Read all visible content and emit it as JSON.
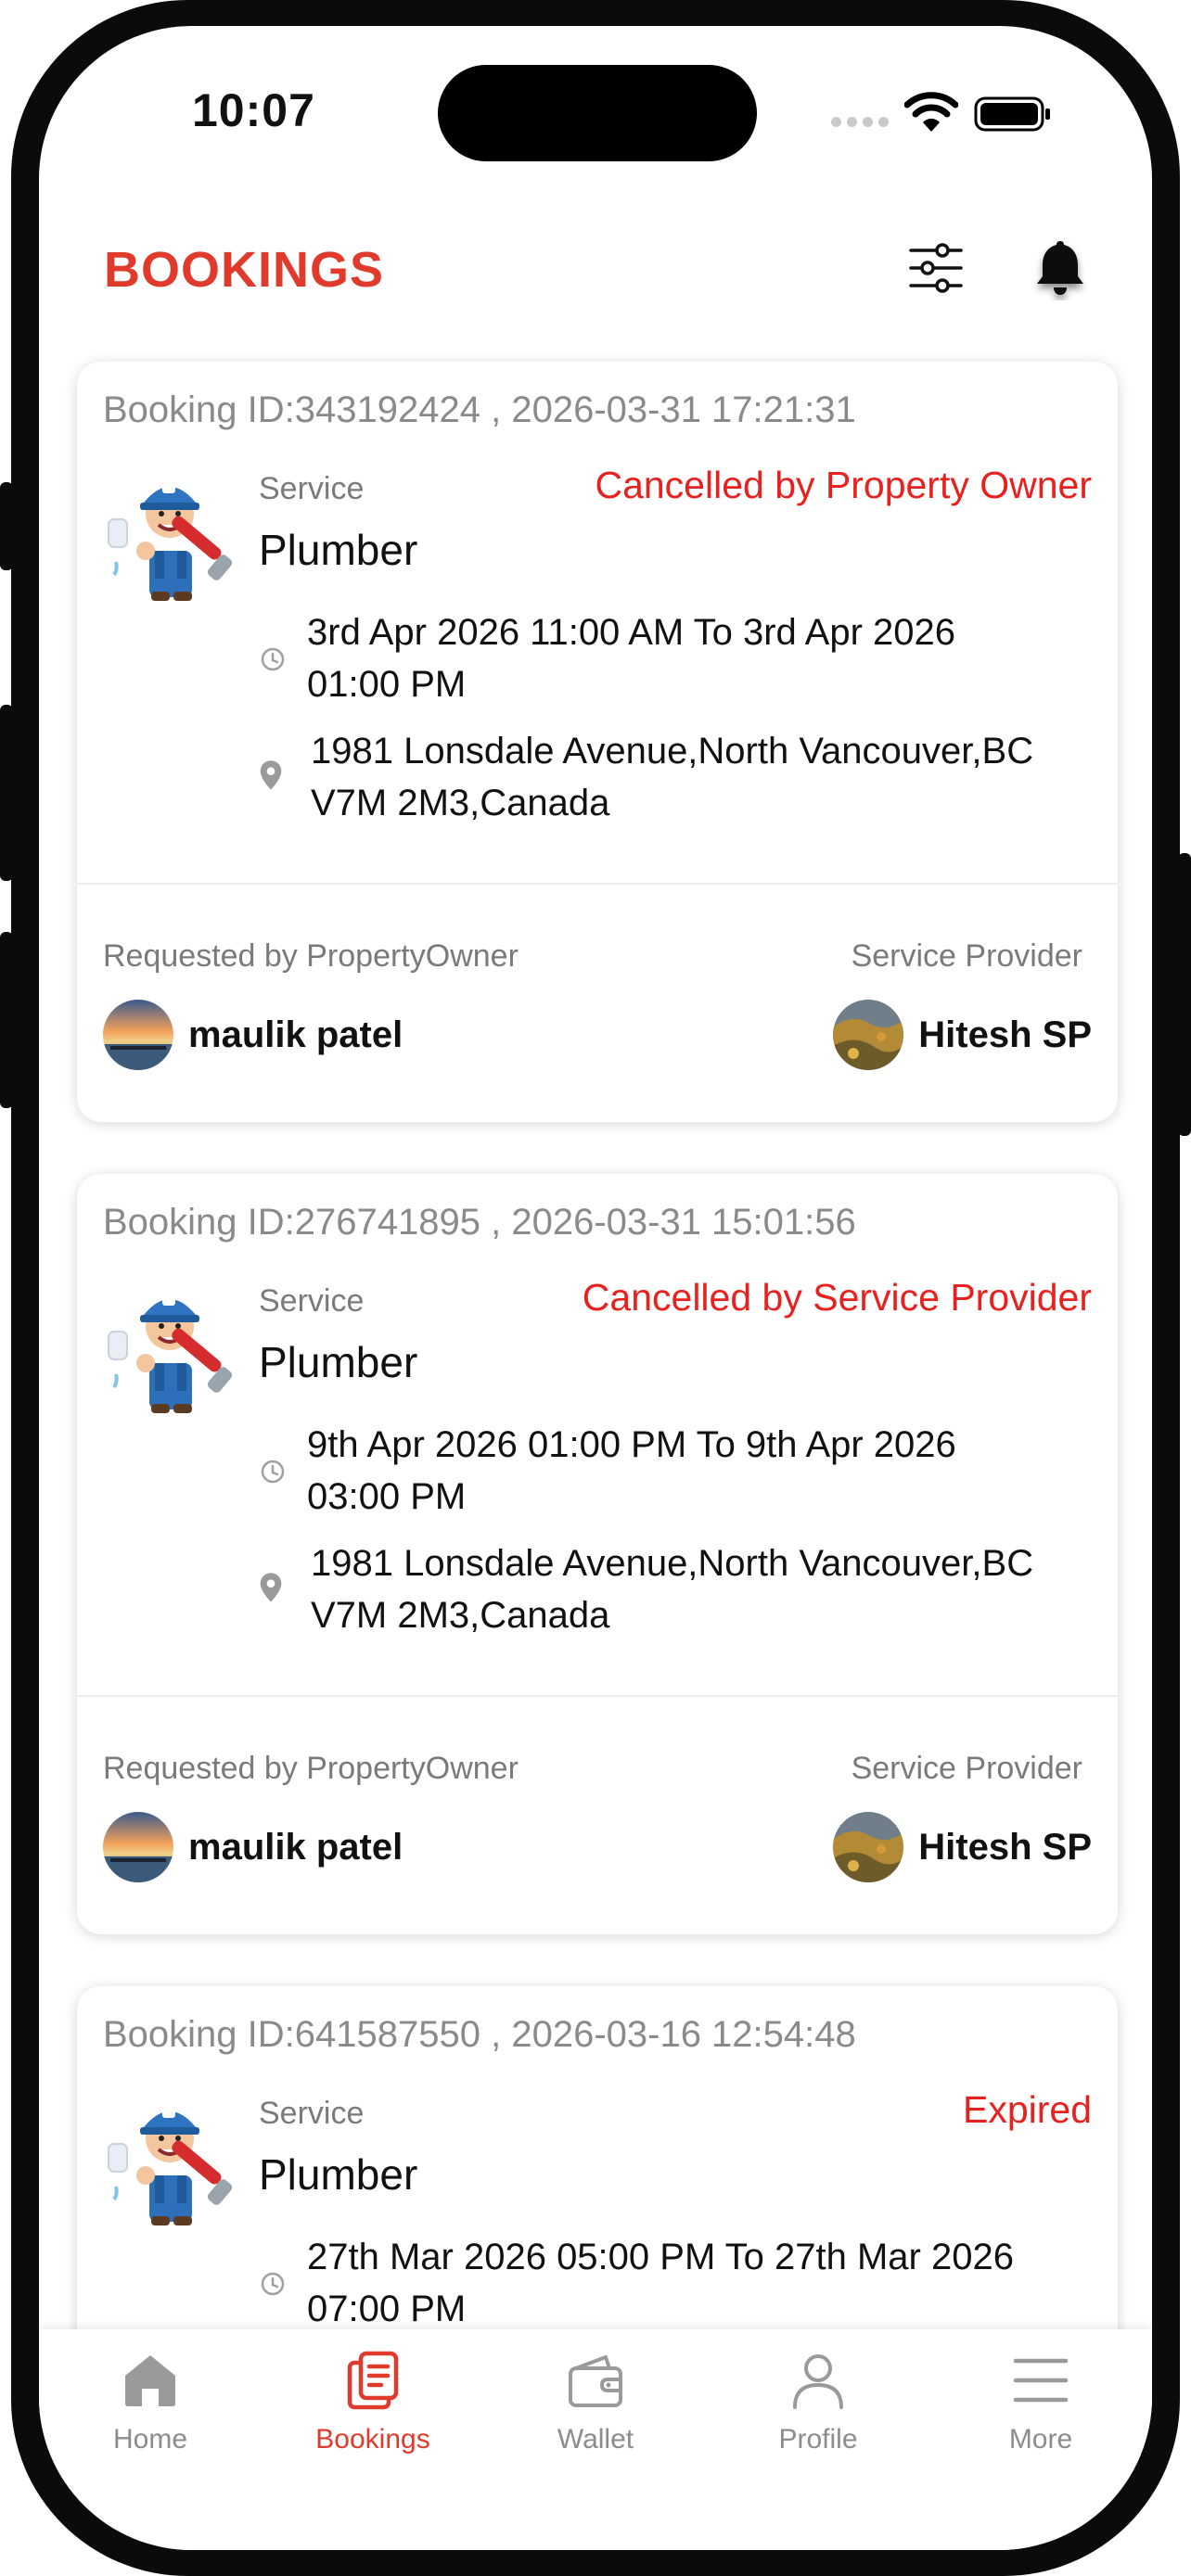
{
  "status_bar": {
    "time": "10:07"
  },
  "header": {
    "title": "BOOKINGS"
  },
  "bookings": [
    {
      "id_line": "Booking ID:343192424 , 2026-03-31 17:21:31",
      "service_label": "Service",
      "status": "Cancelled by Property Owner",
      "service_name": "Plumber",
      "time_line1": "3rd Apr 2026 11:00 AM To 3rd Apr 2026",
      "time_line2": "01:00 PM",
      "address_line1": "1981 Lonsdale Avenue,North Vancouver,BC",
      "address_line2": "V7M 2M3,Canada",
      "requested_label": "Requested by PropertyOwner",
      "requester": "maulik patel",
      "provider_label": "Service Provider",
      "provider": "Hitesh SP"
    },
    {
      "id_line": "Booking ID:276741895 , 2026-03-31 15:01:56",
      "service_label": "Service",
      "status": "Cancelled by Service Provider",
      "service_name": "Plumber",
      "time_line1": "9th Apr 2026 01:00 PM To 9th Apr 2026",
      "time_line2": "03:00 PM",
      "address_line1": "1981 Lonsdale Avenue,North Vancouver,BC",
      "address_line2": "V7M 2M3,Canada",
      "requested_label": "Requested by PropertyOwner",
      "requester": "maulik patel",
      "provider_label": "Service Provider",
      "provider": "Hitesh SP"
    },
    {
      "id_line": "Booking ID:641587550 , 2026-03-16 12:54:48",
      "service_label": "Service",
      "status": "Expired",
      "service_name": "Plumber",
      "time_line1": "27th Mar 2026 05:00 PM To 27th Mar 2026",
      "time_line2": "07:00 PM"
    }
  ],
  "tabs": [
    {
      "label": "Home",
      "icon": "home-icon",
      "active": false
    },
    {
      "label": "Bookings",
      "icon": "bookings-icon",
      "active": true
    },
    {
      "label": "Wallet",
      "icon": "wallet-icon",
      "active": false
    },
    {
      "label": "Profile",
      "icon": "profile-icon",
      "active": false
    },
    {
      "label": "More",
      "icon": "menu-icon",
      "active": false
    }
  ],
  "colors": {
    "accent": "#e03a2c",
    "status_red": "#e8201e",
    "muted": "#8a8a8a"
  }
}
